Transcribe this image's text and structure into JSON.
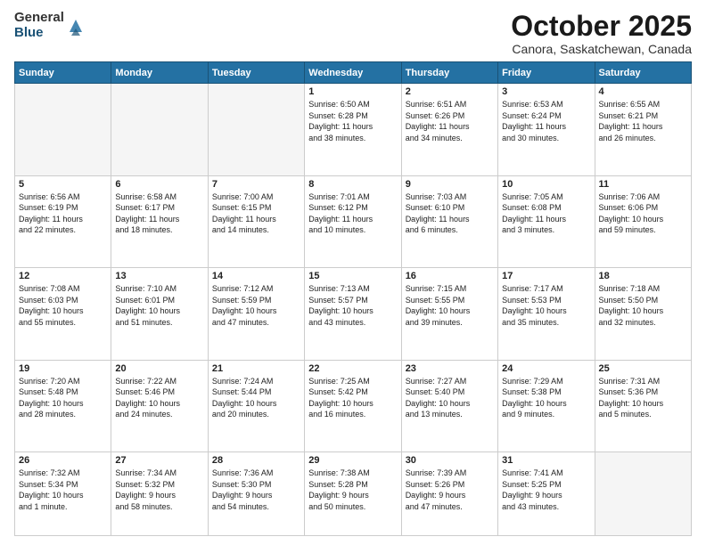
{
  "logo": {
    "general": "General",
    "blue": "Blue"
  },
  "header": {
    "month": "October 2025",
    "location": "Canora, Saskatchewan, Canada"
  },
  "weekdays": [
    "Sunday",
    "Monday",
    "Tuesday",
    "Wednesday",
    "Thursday",
    "Friday",
    "Saturday"
  ],
  "weeks": [
    [
      {
        "day": "",
        "info": ""
      },
      {
        "day": "",
        "info": ""
      },
      {
        "day": "",
        "info": ""
      },
      {
        "day": "1",
        "info": "Sunrise: 6:50 AM\nSunset: 6:28 PM\nDaylight: 11 hours\nand 38 minutes."
      },
      {
        "day": "2",
        "info": "Sunrise: 6:51 AM\nSunset: 6:26 PM\nDaylight: 11 hours\nand 34 minutes."
      },
      {
        "day": "3",
        "info": "Sunrise: 6:53 AM\nSunset: 6:24 PM\nDaylight: 11 hours\nand 30 minutes."
      },
      {
        "day": "4",
        "info": "Sunrise: 6:55 AM\nSunset: 6:21 PM\nDaylight: 11 hours\nand 26 minutes."
      }
    ],
    [
      {
        "day": "5",
        "info": "Sunrise: 6:56 AM\nSunset: 6:19 PM\nDaylight: 11 hours\nand 22 minutes."
      },
      {
        "day": "6",
        "info": "Sunrise: 6:58 AM\nSunset: 6:17 PM\nDaylight: 11 hours\nand 18 minutes."
      },
      {
        "day": "7",
        "info": "Sunrise: 7:00 AM\nSunset: 6:15 PM\nDaylight: 11 hours\nand 14 minutes."
      },
      {
        "day": "8",
        "info": "Sunrise: 7:01 AM\nSunset: 6:12 PM\nDaylight: 11 hours\nand 10 minutes."
      },
      {
        "day": "9",
        "info": "Sunrise: 7:03 AM\nSunset: 6:10 PM\nDaylight: 11 hours\nand 6 minutes."
      },
      {
        "day": "10",
        "info": "Sunrise: 7:05 AM\nSunset: 6:08 PM\nDaylight: 11 hours\nand 3 minutes."
      },
      {
        "day": "11",
        "info": "Sunrise: 7:06 AM\nSunset: 6:06 PM\nDaylight: 10 hours\nand 59 minutes."
      }
    ],
    [
      {
        "day": "12",
        "info": "Sunrise: 7:08 AM\nSunset: 6:03 PM\nDaylight: 10 hours\nand 55 minutes."
      },
      {
        "day": "13",
        "info": "Sunrise: 7:10 AM\nSunset: 6:01 PM\nDaylight: 10 hours\nand 51 minutes."
      },
      {
        "day": "14",
        "info": "Sunrise: 7:12 AM\nSunset: 5:59 PM\nDaylight: 10 hours\nand 47 minutes."
      },
      {
        "day": "15",
        "info": "Sunrise: 7:13 AM\nSunset: 5:57 PM\nDaylight: 10 hours\nand 43 minutes."
      },
      {
        "day": "16",
        "info": "Sunrise: 7:15 AM\nSunset: 5:55 PM\nDaylight: 10 hours\nand 39 minutes."
      },
      {
        "day": "17",
        "info": "Sunrise: 7:17 AM\nSunset: 5:53 PM\nDaylight: 10 hours\nand 35 minutes."
      },
      {
        "day": "18",
        "info": "Sunrise: 7:18 AM\nSunset: 5:50 PM\nDaylight: 10 hours\nand 32 minutes."
      }
    ],
    [
      {
        "day": "19",
        "info": "Sunrise: 7:20 AM\nSunset: 5:48 PM\nDaylight: 10 hours\nand 28 minutes."
      },
      {
        "day": "20",
        "info": "Sunrise: 7:22 AM\nSunset: 5:46 PM\nDaylight: 10 hours\nand 24 minutes."
      },
      {
        "day": "21",
        "info": "Sunrise: 7:24 AM\nSunset: 5:44 PM\nDaylight: 10 hours\nand 20 minutes."
      },
      {
        "day": "22",
        "info": "Sunrise: 7:25 AM\nSunset: 5:42 PM\nDaylight: 10 hours\nand 16 minutes."
      },
      {
        "day": "23",
        "info": "Sunrise: 7:27 AM\nSunset: 5:40 PM\nDaylight: 10 hours\nand 13 minutes."
      },
      {
        "day": "24",
        "info": "Sunrise: 7:29 AM\nSunset: 5:38 PM\nDaylight: 10 hours\nand 9 minutes."
      },
      {
        "day": "25",
        "info": "Sunrise: 7:31 AM\nSunset: 5:36 PM\nDaylight: 10 hours\nand 5 minutes."
      }
    ],
    [
      {
        "day": "26",
        "info": "Sunrise: 7:32 AM\nSunset: 5:34 PM\nDaylight: 10 hours\nand 1 minute."
      },
      {
        "day": "27",
        "info": "Sunrise: 7:34 AM\nSunset: 5:32 PM\nDaylight: 9 hours\nand 58 minutes."
      },
      {
        "day": "28",
        "info": "Sunrise: 7:36 AM\nSunset: 5:30 PM\nDaylight: 9 hours\nand 54 minutes."
      },
      {
        "day": "29",
        "info": "Sunrise: 7:38 AM\nSunset: 5:28 PM\nDaylight: 9 hours\nand 50 minutes."
      },
      {
        "day": "30",
        "info": "Sunrise: 7:39 AM\nSunset: 5:26 PM\nDaylight: 9 hours\nand 47 minutes."
      },
      {
        "day": "31",
        "info": "Sunrise: 7:41 AM\nSunset: 5:25 PM\nDaylight: 9 hours\nand 43 minutes."
      },
      {
        "day": "",
        "info": ""
      }
    ]
  ]
}
